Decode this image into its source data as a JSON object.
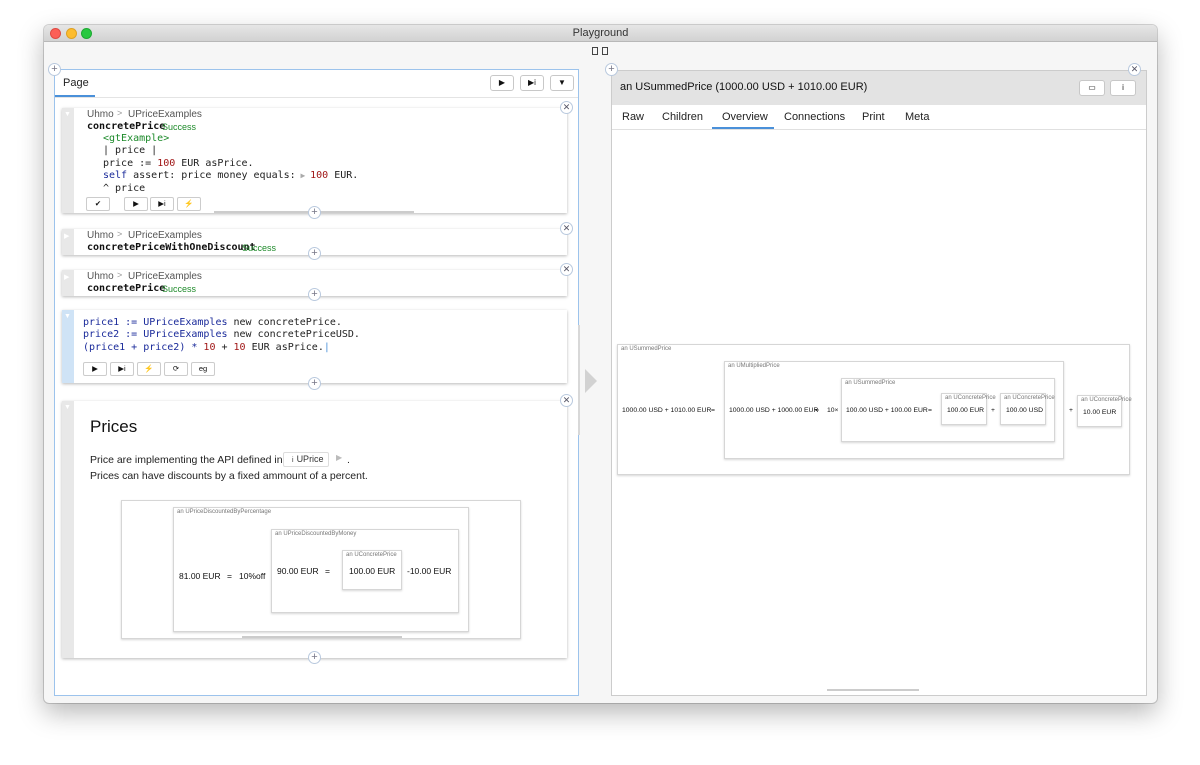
{
  "window": {
    "title": "Playground"
  },
  "left_pane": {
    "tab_label": "Page",
    "snippets": [
      {
        "class_crumb": "Uhmo",
        "separator": ">",
        "class_name": "UPriceExamples",
        "method": "concretePrice",
        "status": "Success",
        "code_lines": {
          "pragma": "<gtExample>",
          "temps": "| price |",
          "l3_a": "price := ",
          "l3_num": "100",
          "l3_b": " EUR asPrice.",
          "l4_self": "self",
          "l4_a": " assert: price money equals:",
          "l4_num": "100",
          "l4_b": " EUR.",
          "l5": "^ price"
        }
      },
      {
        "class_crumb": "Uhmo",
        "separator": ">",
        "class_name": "UPriceExamples",
        "method": "concretePriceWithOneDiscount",
        "status": "Success"
      },
      {
        "class_crumb": "Uhmo",
        "separator": ">",
        "class_name": "UPriceExamples",
        "method": "concretePrice",
        "status": "Success"
      },
      {
        "lines": {
          "l1_a": "price1 := UPriceExamples",
          "l1_b": " new concretePrice.",
          "l2_a": "price2 := UPriceExamples",
          "l2_b": " new concretePriceUSD.",
          "l3_a": "(price1 + price2) * ",
          "l3_n1": "10",
          "l3_b": " + ",
          "l3_n2": "10",
          "l3_c": " EUR asPrice."
        },
        "eg_label": "eg"
      },
      {
        "heading": "Prices",
        "para_before": "Price are implementing the API defined in",
        "link_label": "UPrice",
        "para_after": ".",
        "para2": "Prices can have discounts by a fixed ammount of a percent.",
        "outer_title": "an UPriceDiscountedByPercentage",
        "outer_value": "81.00 EUR",
        "eq1": "=",
        "pct": "10%off",
        "mid_title": "an UPriceDiscountedByMoney",
        "mid_value": "90.00 EUR",
        "eq2": "=",
        "inner_title": "an UConcretePrice",
        "inner_value": "100.00 EUR",
        "minus_value": "-10.00 EUR"
      }
    ]
  },
  "right_pane": {
    "header_title": "an USummedPrice (1000.00 USD + 1010.00 EUR)",
    "tabs": [
      {
        "label": "Raw"
      },
      {
        "label": "Children"
      },
      {
        "label": "Overview",
        "active": true
      },
      {
        "label": "Connections"
      },
      {
        "label": "Print"
      },
      {
        "label": "Meta"
      }
    ],
    "tree": {
      "outer_title": "an USummedPrice",
      "outer_value": "1000.00 USD + 1010.00 EUR",
      "eq1": "=",
      "mult_title": "an UMultipliedPrice",
      "mult_value": "1000.00 USD + 1000.00 EUR",
      "eq2": "=",
      "mult_factor": "10×",
      "sum_title": "an USummedPrice",
      "sum_value": "100.00 USD + 100.00 EUR",
      "eq3": "=",
      "c1_title": "an UConcretePrice",
      "c1_value": "100.00 EUR",
      "plus1": "+",
      "c2_title": "an UConcretePrice",
      "c2_value": "100.00 USD",
      "plus2": "+",
      "c3_title": "an UConcretePrice",
      "c3_value": "10.00 EUR"
    }
  },
  "colors": {
    "accent": "#4a90d9",
    "success": "#1e8a2a",
    "number": "#a01616",
    "keyword": "#1a2a9a"
  }
}
